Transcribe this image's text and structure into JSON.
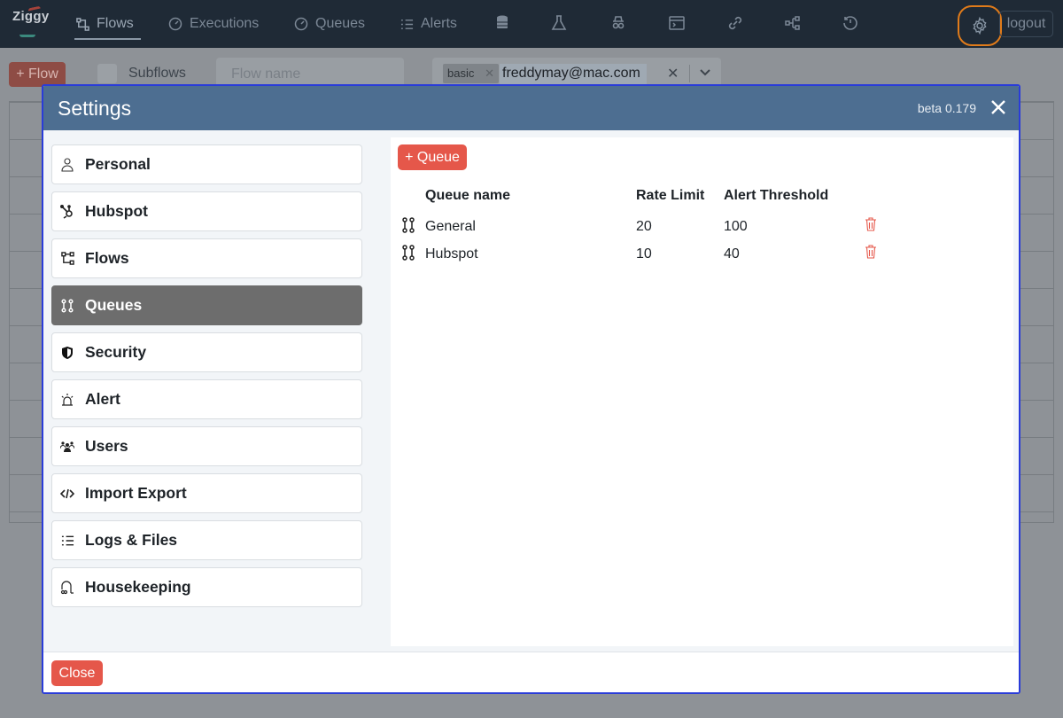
{
  "brand": {
    "name": "Ziggy"
  },
  "nav": {
    "items": [
      {
        "label": "Flows",
        "icon": "flows-icon"
      },
      {
        "label": "Executions",
        "icon": "gauge-icon"
      },
      {
        "label": "Queues",
        "icon": "gauge-icon"
      },
      {
        "label": "Alerts",
        "icon": "list-icon"
      }
    ],
    "icon_buttons": [
      "database-icon",
      "flask-icon",
      "spy-icon",
      "terminal-icon",
      "link-icon",
      "hierarchy-icon",
      "history-icon"
    ],
    "logout_label": "logout",
    "settings_icon": "gear-icon"
  },
  "toolbar": {
    "add_flow_label": "+ Flow",
    "subflows_label": "Subflows",
    "flow_name_placeholder": "Flow name",
    "tag_chip": "basic",
    "tag_value": "freddymay@mac.com"
  },
  "settings": {
    "title": "Settings",
    "version": "beta 0.179",
    "close_label": "Close",
    "sidebar": [
      {
        "label": "Personal",
        "icon": "person-icon",
        "active": false
      },
      {
        "label": "Hubspot",
        "icon": "hubspot-icon",
        "active": false
      },
      {
        "label": "Flows",
        "icon": "flows-icon",
        "active": false
      },
      {
        "label": "Queues",
        "icon": "queue-icon",
        "active": true
      },
      {
        "label": "Security",
        "icon": "shield-icon",
        "active": false
      },
      {
        "label": "Alert",
        "icon": "siren-icon",
        "active": false
      },
      {
        "label": "Users",
        "icon": "users-icon",
        "active": false
      },
      {
        "label": "Import Export",
        "icon": "code-icon",
        "active": false
      },
      {
        "label": "Logs & Files",
        "icon": "list-icon",
        "active": false
      },
      {
        "label": "Housekeeping",
        "icon": "vacuum-icon",
        "active": false
      }
    ],
    "queues": {
      "add_label": "+ Queue",
      "columns": [
        "Queue name",
        "Rate Limit",
        "Alert Threshold"
      ],
      "rows": [
        {
          "name": "General",
          "rate_limit": "20",
          "alert_threshold": "100"
        },
        {
          "name": "Hubspot",
          "rate_limit": "10",
          "alert_threshold": "40"
        }
      ]
    }
  },
  "colors": {
    "accent": "#e5574a",
    "header": "#4d6e91",
    "active_item": "#6d6d6d",
    "highlight_ring": "#e07b1a"
  }
}
